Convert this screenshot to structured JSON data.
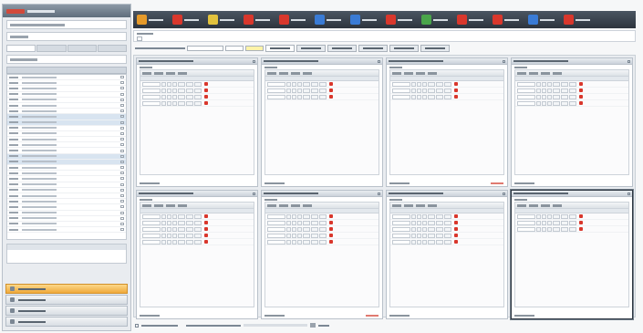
{
  "window": {
    "title": ""
  },
  "left": {
    "brand": "",
    "nav_buttons": [
      {
        "label": "",
        "icon": "folder-icon",
        "active": true
      },
      {
        "label": "",
        "icon": "list-icon",
        "active": false
      },
      {
        "label": "",
        "icon": "calendar-icon",
        "active": false
      },
      {
        "label": "",
        "icon": "settings-icon",
        "active": false
      }
    ],
    "list_rows": 28,
    "selected_rows": [
      7,
      8,
      14,
      15
    ]
  },
  "toolbar": {
    "items": [
      {
        "icon": "new-icon",
        "color": "#e69a2a"
      },
      {
        "icon": "open-icon",
        "color": "#d9372c"
      },
      {
        "icon": "save-icon",
        "color": "#e2c23d"
      },
      {
        "icon": "print-icon",
        "color": "#d9372c"
      },
      {
        "icon": "copy-icon",
        "color": "#d9372c"
      },
      {
        "icon": "globe-icon",
        "color": "#3a7bd5"
      },
      {
        "icon": "info-icon",
        "color": "#3a7bd5"
      },
      {
        "icon": "grid-icon",
        "color": "#d9372c"
      },
      {
        "icon": "image-icon",
        "color": "#4aa54a"
      },
      {
        "icon": "book-icon",
        "color": "#d9372c"
      },
      {
        "icon": "lock-icon",
        "color": "#d9372c"
      },
      {
        "icon": "refresh-icon",
        "color": "#3a7bd5"
      },
      {
        "icon": "close-icon",
        "color": "#d9372c"
      }
    ]
  },
  "filter": {
    "tabs": [
      "",
      "",
      "",
      "",
      "",
      ""
    ],
    "active_tab": 0
  },
  "panels": [
    {
      "rows": 4,
      "footer_right": false
    },
    {
      "rows": 3,
      "footer_right": false
    },
    {
      "rows": 3,
      "footer_right": true
    },
    {
      "rows": 4,
      "footer_right": false
    },
    {
      "rows": 5,
      "footer_right": false
    },
    {
      "rows": 5,
      "footer_right": true
    },
    {
      "rows": 5,
      "footer_right": false
    },
    {
      "rows": 3,
      "footer_right": false
    }
  ],
  "highlighted_panel": 7
}
